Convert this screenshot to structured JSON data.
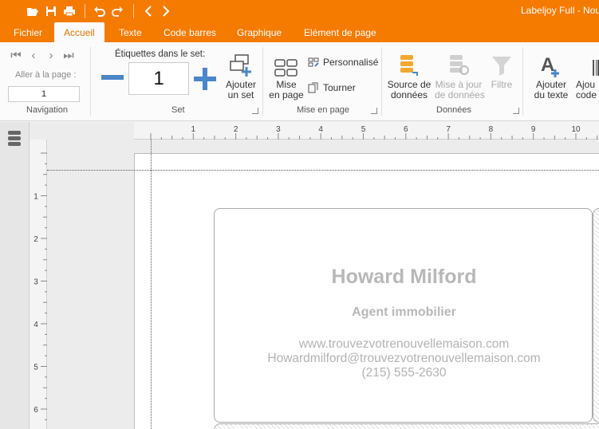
{
  "app": {
    "title": "Labeljoy Full - Nou"
  },
  "tabs": [
    {
      "label": "Fichier"
    },
    {
      "label": "Accueil"
    },
    {
      "label": "Texte"
    },
    {
      "label": "Code barres"
    },
    {
      "label": "Graphique"
    },
    {
      "label": "Elément de page"
    }
  ],
  "ribbon": {
    "navigation": {
      "goto_label": "Aller à la page :",
      "goto_value": "1",
      "group_label": "Navigation"
    },
    "set": {
      "label": "Étiquettes dans le set:",
      "value": "1",
      "add_label_1": "Ajouter",
      "add_label_2": "un set",
      "group_label": "Set"
    },
    "layout": {
      "page_label_1": "Mise",
      "page_label_2": "en page",
      "custom_label": "Personnalisé",
      "rotate_label": "Tourner",
      "group_label": "Mise en page"
    },
    "data": {
      "source_1": "Source de",
      "source_2": "données",
      "update_1": "Mise à jour",
      "update_2": "de données",
      "filter": "Filtre",
      "group_label": "Données"
    },
    "insert": {
      "text_1": "Ajouter",
      "text_2": "du texte",
      "code_1": "Ajou",
      "code_2": "code"
    }
  },
  "card": {
    "name": "Howard Milford",
    "role": "Agent immobilier",
    "website": "www.trouvezvotrenouvellemaison.com",
    "email": "Howardmilford@trouvezvotrenouvellemaison.com",
    "phone": "(215) 555-2630"
  },
  "ruler": {
    "h": [
      "1",
      "2",
      "3",
      "4",
      "5",
      "6",
      "7",
      "8",
      "9",
      "10"
    ],
    "v": [
      "1",
      "2",
      "3",
      "4",
      "5",
      "6"
    ]
  }
}
